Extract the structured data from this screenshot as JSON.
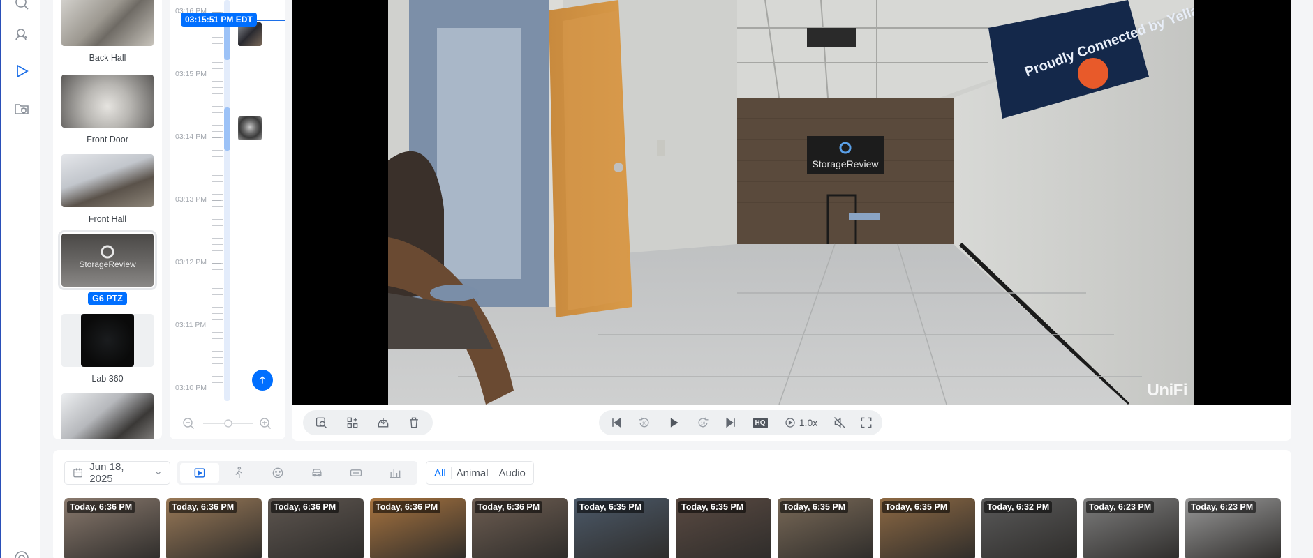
{
  "rail": {
    "icons": [
      "search-camera-icon",
      "face-scan-icon",
      "play-icon",
      "folder-shield-icon"
    ]
  },
  "cameras": [
    {
      "name": "Back Hall",
      "active": false
    },
    {
      "name": "Front Door",
      "active": false
    },
    {
      "name": "Front Hall",
      "active": false
    },
    {
      "name": "G6 PTZ",
      "active": true
    },
    {
      "name": "Lab 360",
      "active": false
    }
  ],
  "timeline": {
    "current_time": "03:15:51 PM EDT",
    "labels": [
      "03:16 PM",
      "03:15 PM",
      "03:14 PM",
      "03:13 PM",
      "03:12 PM",
      "03:11 PM",
      "03:10 PM"
    ]
  },
  "player": {
    "watermark": "UniFi",
    "banner_text": "Proudly Connected by Yellamox Fast Interconnect",
    "wall_logo": "StorageReview"
  },
  "controls": {
    "speed": "1.0x",
    "quality": "HQ",
    "skip_back": "10",
    "skip_forward": "10"
  },
  "events": {
    "date": "Jun 18, 2025",
    "filters": [
      "All",
      "Animal",
      "Audio"
    ],
    "active_filter": "All",
    "cards": [
      {
        "label": "Today, 6:36 PM",
        "bg": "#8a7a6e"
      },
      {
        "label": "Today, 6:36 PM",
        "bg": "#9a7a58"
      },
      {
        "label": "Today, 6:36 PM",
        "bg": "#5e5650"
      },
      {
        "label": "Today, 6:36 PM",
        "bg": "#a8743f"
      },
      {
        "label": "Today, 6:36 PM",
        "bg": "#6e5e52"
      },
      {
        "label": "Today, 6:35 PM",
        "bg": "#4c5a6a"
      },
      {
        "label": "Today, 6:35 PM",
        "bg": "#5a4a42"
      },
      {
        "label": "Today, 6:35 PM",
        "bg": "#7a6a58"
      },
      {
        "label": "Today, 6:35 PM",
        "bg": "#8e6a44"
      },
      {
        "label": "Today, 6:32 PM",
        "bg": "#5a5a5a"
      },
      {
        "label": "Today, 6:23 PM",
        "bg": "#7e7e7e"
      },
      {
        "label": "Today, 6:23 PM",
        "bg": "#9a9a9a"
      }
    ]
  }
}
